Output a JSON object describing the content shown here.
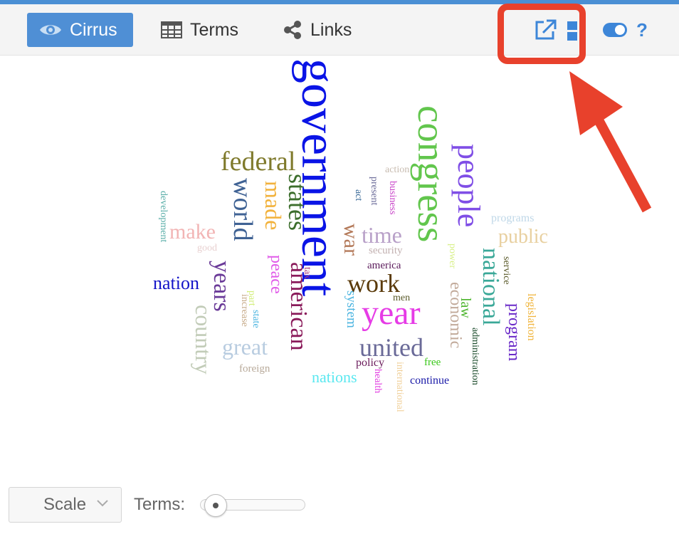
{
  "tabs": [
    {
      "label": "Cirrus",
      "icon": "eye-icon",
      "active": true
    },
    {
      "label": "Terms",
      "icon": "table-grid-icon",
      "active": false
    },
    {
      "label": "Links",
      "icon": "share-nodes-icon",
      "active": false
    }
  ],
  "toolbar_tools": [
    "export-icon",
    "window-icon",
    "toggle-icon",
    "help-icon"
  ],
  "accent_color": "#4f8fd5",
  "annotation_color": "#e8412c",
  "words": [
    {
      "text": "government",
      "color": "#0a14e6"
    },
    {
      "text": "congress",
      "color": "#62c64d"
    },
    {
      "text": "people",
      "color": "#7f4ee6"
    },
    {
      "text": "federal",
      "color": "#7f7a2c"
    },
    {
      "text": "world",
      "color": "#3f6294"
    },
    {
      "text": "states",
      "color": "#3c6e2c"
    },
    {
      "text": "made",
      "color": "#f2b23c"
    },
    {
      "text": "make",
      "color": "#f2b4b4"
    },
    {
      "text": "good",
      "color": "#e8d0d0"
    },
    {
      "text": "development",
      "color": "#5aaea8"
    },
    {
      "text": "nation",
      "color": "#1414c8"
    },
    {
      "text": "years",
      "color": "#6a3a98"
    },
    {
      "text": "country",
      "color": "#c2ccb8"
    },
    {
      "text": "great",
      "color": "#b8cce0"
    },
    {
      "text": "foreign",
      "color": "#b8aa9a"
    },
    {
      "text": "increase",
      "color": "#c6aa88"
    },
    {
      "text": "part",
      "color": "#d2ee7a"
    },
    {
      "text": "state",
      "color": "#4ab4e0"
    },
    {
      "text": "peace",
      "color": "#e05ae8"
    },
    {
      "text": "american",
      "color": "#8a1a5a"
    },
    {
      "text": "tax",
      "color": "#a8367a"
    },
    {
      "text": "war",
      "color": "#b47a5a"
    },
    {
      "text": "act",
      "color": "#3a6a98"
    },
    {
      "text": "present",
      "color": "#6a6a98"
    },
    {
      "text": "business",
      "color": "#c844c8"
    },
    {
      "text": "action",
      "color": "#c8bcb0"
    },
    {
      "text": "time",
      "color": "#b8a0c8"
    },
    {
      "text": "security",
      "color": "#c2b0b0"
    },
    {
      "text": "america",
      "color": "#5a1a5a"
    },
    {
      "text": "work",
      "color": "#5a3a0a"
    },
    {
      "text": "men",
      "color": "#5a5a2a"
    },
    {
      "text": "power",
      "color": "#d8f08a"
    },
    {
      "text": "system",
      "color": "#4ab4e0"
    },
    {
      "text": "year",
      "color": "#e63ce6"
    },
    {
      "text": "economic",
      "color": "#c2aa9a"
    },
    {
      "text": "united",
      "color": "#6a6a98"
    },
    {
      "text": "policy",
      "color": "#6a1a5a"
    },
    {
      "text": "nations",
      "color": "#5ae8f0"
    },
    {
      "text": "health",
      "color": "#e03ae0"
    },
    {
      "text": "international",
      "color": "#f0d09a"
    },
    {
      "text": "free",
      "color": "#3ac81a"
    },
    {
      "text": "continue",
      "color": "#1a1aa8"
    },
    {
      "text": "law",
      "color": "#4ab42a"
    },
    {
      "text": "national",
      "color": "#3aa898"
    },
    {
      "text": "administration",
      "color": "#1a4a2a"
    },
    {
      "text": "programs",
      "color": "#c0d8e8"
    },
    {
      "text": "public",
      "color": "#e8d0a0"
    },
    {
      "text": "service",
      "color": "#5a5a2a"
    },
    {
      "text": "program",
      "color": "#6a2ac8"
    },
    {
      "text": "legislation",
      "color": "#f0b43a"
    }
  ],
  "footer": {
    "scale_label": "Scale",
    "terms_label": "Terms:",
    "terms_slider_fraction": 0.05
  }
}
